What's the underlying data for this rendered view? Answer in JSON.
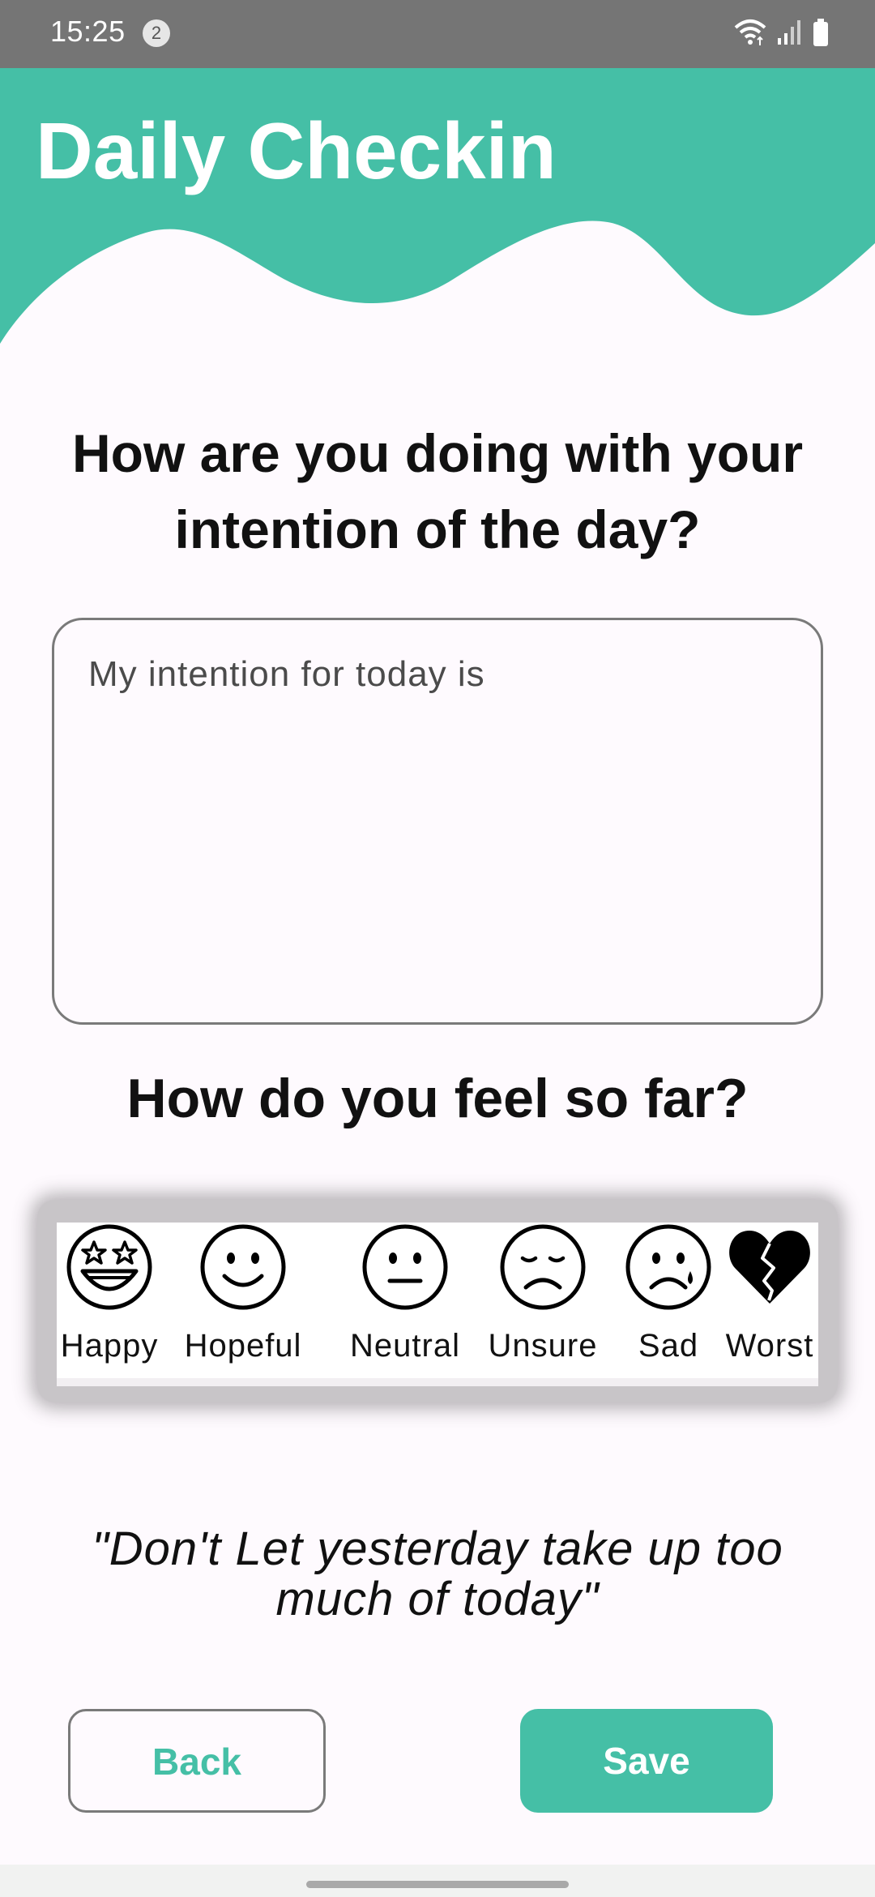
{
  "status_bar": {
    "time": "15:25",
    "notification_count": "2",
    "icons": [
      "wifi-icon",
      "signal-icon",
      "battery-icon"
    ]
  },
  "header": {
    "title": "Daily Checkin",
    "accent_color": "#45BFA6"
  },
  "intention": {
    "question": "How are you doing with your intention of the day?",
    "value": "",
    "placeholder": "My intention for today is"
  },
  "feeling": {
    "question": "How do you feel so far?",
    "moods": [
      {
        "label": "Happy",
        "icon": "star-struck-face-icon"
      },
      {
        "label": "Hopeful",
        "icon": "smiling-face-icon"
      },
      {
        "label": "Neutral",
        "icon": "neutral-face-icon"
      },
      {
        "label": "Unsure",
        "icon": "worried-face-icon"
      },
      {
        "label": "Sad",
        "icon": "crying-face-icon"
      },
      {
        "label": "Worst",
        "icon": "broken-heart-icon"
      }
    ]
  },
  "quote": "\"Don't Let yesterday take up too much of today\"",
  "buttons": {
    "back_label": "Back",
    "save_label": "Save"
  },
  "colors": {
    "accent": "#45BFA6",
    "background": "#FEFAFE",
    "status_bar": "#757575",
    "text": "#111111"
  }
}
